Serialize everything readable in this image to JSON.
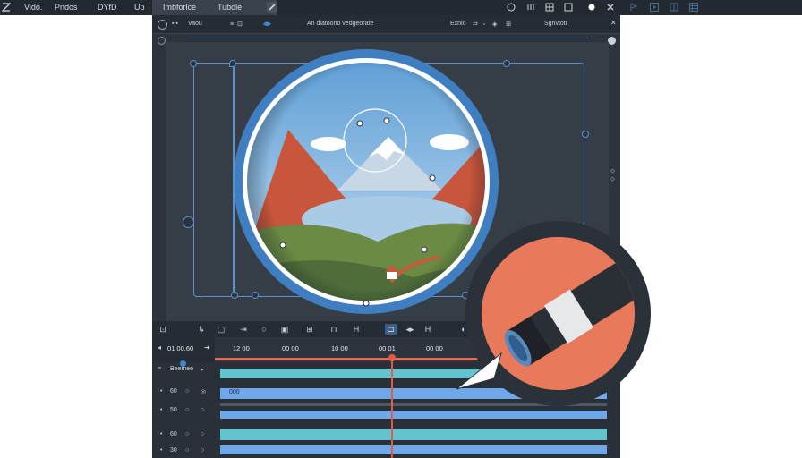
{
  "menubar": {
    "items": [
      "Vido.",
      "Pndos",
      "DYfD",
      "Up",
      "Imbforlce",
      "Tubdle"
    ],
    "accent": "#3d86d1"
  },
  "toolbar": {
    "left_label": "Vaou",
    "center_label": "An diatoono vedgeorate",
    "right_label": "Exnio",
    "far_right_label": "Sgnvtotr"
  },
  "timeline": {
    "timecodes": [
      "01 00.60",
      "12 00",
      "00 00",
      "10 00",
      "00 01",
      "00 00"
    ],
    "tracks": [
      {
        "label": "Beemee",
        "value": ""
      },
      {
        "label": "60",
        "value": "000"
      },
      {
        "label": "50",
        "value": ""
      },
      {
        "label": "60",
        "value": ""
      },
      {
        "label": "30",
        "value": ""
      }
    ],
    "playhead_color": "#e15c48"
  },
  "colors": {
    "bg": "#2d343d",
    "track_teal": "#63c3cf",
    "track_blue": "#6ea7ea",
    "ruler_red": "#e36b57",
    "circle_blue": "#3f7ec0",
    "loupe_orange": "#e8795a"
  },
  "icons": {
    "play": "play-icon",
    "settings": "gear-icon",
    "close": "close-icon",
    "zoom": "loupe-icon"
  }
}
